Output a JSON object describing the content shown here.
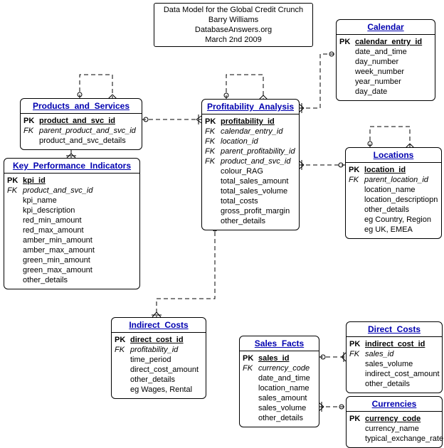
{
  "title": {
    "line1": "Data Model for the Global Credit Crunch",
    "line2": "Barry Williams",
    "line3": "DatabaseAnswers.org",
    "line4": "March 2nd 2009"
  },
  "entities": {
    "calendar": {
      "name": "Calendar",
      "pk": "calendar_entry_id",
      "fields": [
        "date_and_time",
        "day_number",
        "week_number",
        "year_number",
        "day_date"
      ]
    },
    "prod": {
      "name": "Products_and_Services",
      "pk": "product_and_svc_id",
      "fk1": "parent_product_and_svc_id",
      "f1": "product_and_svc_details"
    },
    "prof": {
      "name": "Profitability_Analysis",
      "pk": "profitability_id",
      "fk1": "calendar_entry_id",
      "fk2": "location_id",
      "fk3": "parent_profitability_id",
      "fk4": "product_and_svc_id",
      "fields": [
        "colour_RAG",
        "total_sales_amount",
        "total_sales_volume",
        "total_costs",
        "gross_profit_margin",
        "other_details"
      ]
    },
    "loc": {
      "name": "Locations",
      "pk": "location_id",
      "fk1": "parent_location_id",
      "fields": [
        "location_name",
        "location_descriptiopn",
        "other_details",
        "eg Country, Region",
        "eg UK, EMEA"
      ]
    },
    "kpi": {
      "name": "Key_Performance_Indicators",
      "pk": "kpi_id",
      "fk1": "product_and_svc_id",
      "fields": [
        "kpi_name",
        "kpi_description",
        "red_min_amount",
        "red_max_amount",
        "amber_min_amount",
        "amber_max_amount",
        "green_min_amount",
        "green_max_amount",
        "other_details"
      ]
    },
    "ind": {
      "name": "Indirect_Costs",
      "pk": "direct_cost_id",
      "fk1": "profitability_id",
      "fields": [
        "time_period",
        "direct_cost_amount",
        "other_details",
        "eg Wages, Rental"
      ]
    },
    "sales": {
      "name": "Sales_Facts",
      "pk": "sales_id",
      "fk1": "currency_code",
      "fields": [
        "date_and_time",
        "location_name",
        "sales_amount",
        "sales_volume",
        "other_details"
      ]
    },
    "direct": {
      "name": "Direct_Costs",
      "pk": "indirect_cost_id",
      "fk1": "sales_id",
      "fields": [
        "sales_volume",
        "indirect_cost_amount",
        "other_details"
      ]
    },
    "curr": {
      "name": "Currencies",
      "pk": "currency_code",
      "fields": [
        "currency_name",
        "typical_exchange_rate"
      ]
    }
  },
  "keys": {
    "pk": "PK",
    "fk": "FK"
  }
}
